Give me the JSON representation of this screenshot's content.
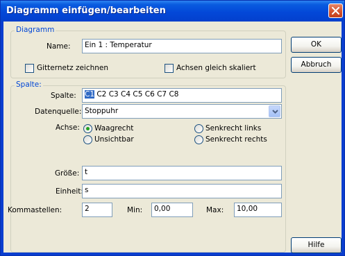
{
  "window": {
    "title": "Diagramm einfügen/bearbeiten"
  },
  "diagramm": {
    "legend": "Diagramm",
    "name_label": "Name:",
    "name_value": "Ein 1 : Temperatur",
    "grid_label": "Gitternetz zeichnen",
    "grid_checked": false,
    "axes_equal_label": "Achsen gleich skaliert",
    "axes_equal_checked": false
  },
  "spalte": {
    "legend": "Spalte:",
    "spalte_label": "Spalte:",
    "columns_selected": "C1",
    "columns_rest": " C2  C3  C4  C5  C6  C7  C8",
    "datenquelle_label": "Datenquelle:",
    "datenquelle_value": "Stoppuhr",
    "achse_label": "Achse:",
    "axis_options": {
      "waagrecht": "Waagrecht",
      "unsichtbar": "Unsichtbar",
      "senkrecht_links": "Senkrecht links",
      "senkrecht_rechts": "Senkrecht rechts"
    },
    "axis_selected": "Waagrecht",
    "groesse_label": "Größe:",
    "groesse_value": "t",
    "einheit_label": "Einheit:",
    "einheit_value": "s",
    "kommastellen_label": "Kommastellen:",
    "kommastellen_value": "2",
    "min_label": "Min:",
    "min_value": "0,00",
    "max_label": "Max:",
    "max_value": "10,00"
  },
  "buttons": {
    "ok": "OK",
    "abbruch": "Abbruch",
    "hilfe": "Hilfe"
  },
  "colors": {
    "titlebar": "#0348d8",
    "group_legend": "#0046d5",
    "selection": "#316ac5",
    "radio_dot": "#21a121"
  }
}
